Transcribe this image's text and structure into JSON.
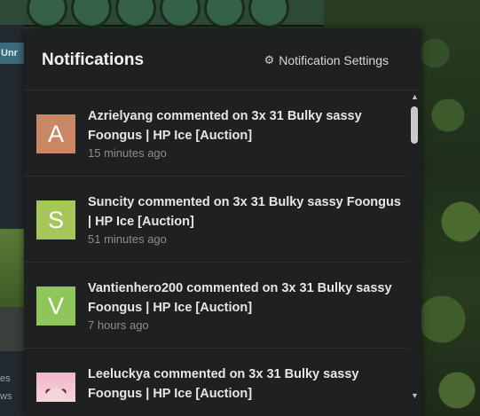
{
  "background": {
    "left_tab_label": "Unr",
    "left_text_1": "es",
    "left_text_2": "ws"
  },
  "panel": {
    "title": "Notifications",
    "settings_label": "Notification Settings",
    "settings_icon": "gear-icon"
  },
  "notifications": [
    {
      "avatar_letter": "A",
      "avatar_color": "#c98763",
      "text": "Azrielyang commented on 3x 31 Bulky sassy Foongus | HP Ice [Auction]",
      "time": "15 minutes ago"
    },
    {
      "avatar_letter": "S",
      "avatar_color": "#a6c65a",
      "text": "Suncity commented on 3x 31 Bulky sassy Foongus | HP Ice [Auction]",
      "time": "51 minutes ago"
    },
    {
      "avatar_letter": "V",
      "avatar_color": "#8fc65a",
      "text": "Vantienhero200 commented on 3x 31 Bulky sassy Foongus | HP Ice [Auction]",
      "time": "7 hours ago"
    },
    {
      "avatar_letter": "",
      "avatar_color": "#f2b6c8",
      "text": "Leeluckya commented on 3x 31 Bulky sassy Foongus | HP Ice [Auction]",
      "time": ""
    }
  ]
}
